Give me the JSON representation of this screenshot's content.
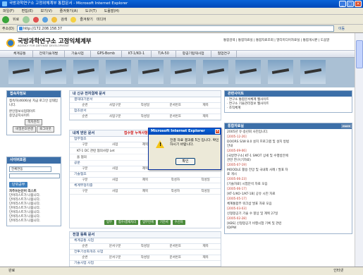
{
  "window": {
    "title": "국방과학연구소 고정위체계부 통합문서 - Microsoft Internet Explorer"
  },
  "menu": [
    "파일(F)",
    "편집(E)",
    "보기(V)",
    "즐겨찾기(A)",
    "도구(T)",
    "도움말(H)"
  ],
  "toolbar": {
    "back_label": "뒤로",
    "search_label": "검색",
    "favorites_label": "즐겨찾기",
    "media_label": "미디어"
  },
  "address": {
    "label": "주소(D)",
    "url": "http://172.208.158.37",
    "go_label": "이동"
  },
  "site": {
    "title": "국방과학연구소 고정익체계부",
    "subtitle": "AGENCY FOR DEFENSE DEVELOPMENT",
    "top_links": "통합검색 | 통합자료실 | 통합자료조회 | 멀티미디어자료실 | 통합게시판 | 도움말"
  },
  "gnb": [
    "체계공통",
    "전략기술개발",
    "기술사업",
    "GPS-Bomb",
    "KT-1/KO-1",
    "T/A-50",
    "항공기탑재사업",
    "협업연구"
  ],
  "left": {
    "box1_title": "접속자정보",
    "box1_text": "접속자(4606)님 지금 로그인 상태입니다.",
    "box1_link1": "본인정보사업데이트",
    "box1_link2": "중앙공지사이트",
    "btn_memo": "쪽지관리",
    "btn_pw": "비밀번호변경",
    "btn_logout": "로그아웃",
    "box2_title": "사이버포럼",
    "select_value": "전체연동",
    "cyber_btn": "단위공무",
    "cyber_sub": "자주쓰는단어 리스트",
    "links": [
      "단어리스트가 나옵니다.",
      "단어리스트가 나옵니다.",
      "단어리스트가 나옵니다.",
      "단어리스트가 나옵니다.",
      "단어리스트가 나옵니다.",
      "단어리스트가 나옵니다.",
      "단어리스트가 나옵니다."
    ]
  },
  "center": {
    "s1_title": "내 신규 전자결재 문서",
    "s1_sub1": "결재대기문서",
    "s1_sub2": "참조문서",
    "s2_title": "내게 받은 문서",
    "s2_alert": "접수할 누적사항",
    "s2_sub1": "업무협조",
    "s2_doc": "KT-1 DC 관련 협의사항 Let",
    "s2_doc2": "을 협의",
    "s2_sub2": "공문",
    "s2_sub3": "기술협조",
    "s2_sub4": "체계부정리중",
    "cols": [
      "순번",
      "사업구분",
      "작성일",
      "문서번호",
      "제목"
    ],
    "cols2": [
      "구분",
      "사업",
      "제목",
      "작성자",
      "작성일"
    ],
    "actions": [
      "업무",
      "접수/결재처리",
      "업무연계",
      "기안서",
      "수신자"
    ],
    "s3_title": "전결 등록 문서",
    "s3_sub1": "체계공통 사업",
    "s3_sub2": "전투기성화개조 사업",
    "s3_sub3": "기술사업 사업",
    "cols3": [
      "순번",
      "문서구분",
      "작성일",
      "문서번호",
      "제목"
    ]
  },
  "right": {
    "box1_title": "관련사이트",
    "box1_items": [
      "· 연구소 통합문서체계 웹사이트",
      "· 연구소 기술관리정보 웹사이트",
      "· 조직체계"
    ],
    "box2_title": "통합자료실",
    "more": "more",
    "news": [
      {
        "title": "2005년 유·송년회 사진입니다.",
        "date": "[2005-12-26]"
      },
      {
        "title": "DOORS S/W 8.0 설치 프로그램 및 설치 방법 안내",
        "date": "[2005-09-06]"
      },
      {
        "title": "[국방연구소] KT-1 SMOT 상세 및 수행방안에 관한 연구(기자료)",
        "date": "[2005-07-19]"
      },
      {
        "title": "MOODLE 활용 전망 및 국내외 사례 / 발표 자료 게시",
        "date": "[2005-06-23]"
      },
      {
        "title": "[기술자료] 시험분석 자료 모음",
        "date": "[2005-06-17]"
      },
      {
        "title": "[KT-1/KO-1/KT-1B] 공유 시진 자료",
        "date": "[2005-05-17]"
      },
      {
        "title": "체계통합부 워크샵 발표 자료 모음",
        "date": "[2005-03-03]"
      },
      {
        "title": "신형항공기 기술 수 향상 및 계획 27일",
        "date": "[2005-02-28]"
      },
      {
        "title": "[KBS] 신형항공기 비행시험 기록 및 관련 ID/PW",
        "date": ""
      }
    ]
  },
  "dialog": {
    "title": "Microsoft Internet Explorer",
    "message": "전결 자료 결과를 5건 입니다. 확인하시기 바랍니다.",
    "ok": "확인"
  },
  "status": {
    "left": "완료",
    "zone": "인터넷"
  }
}
